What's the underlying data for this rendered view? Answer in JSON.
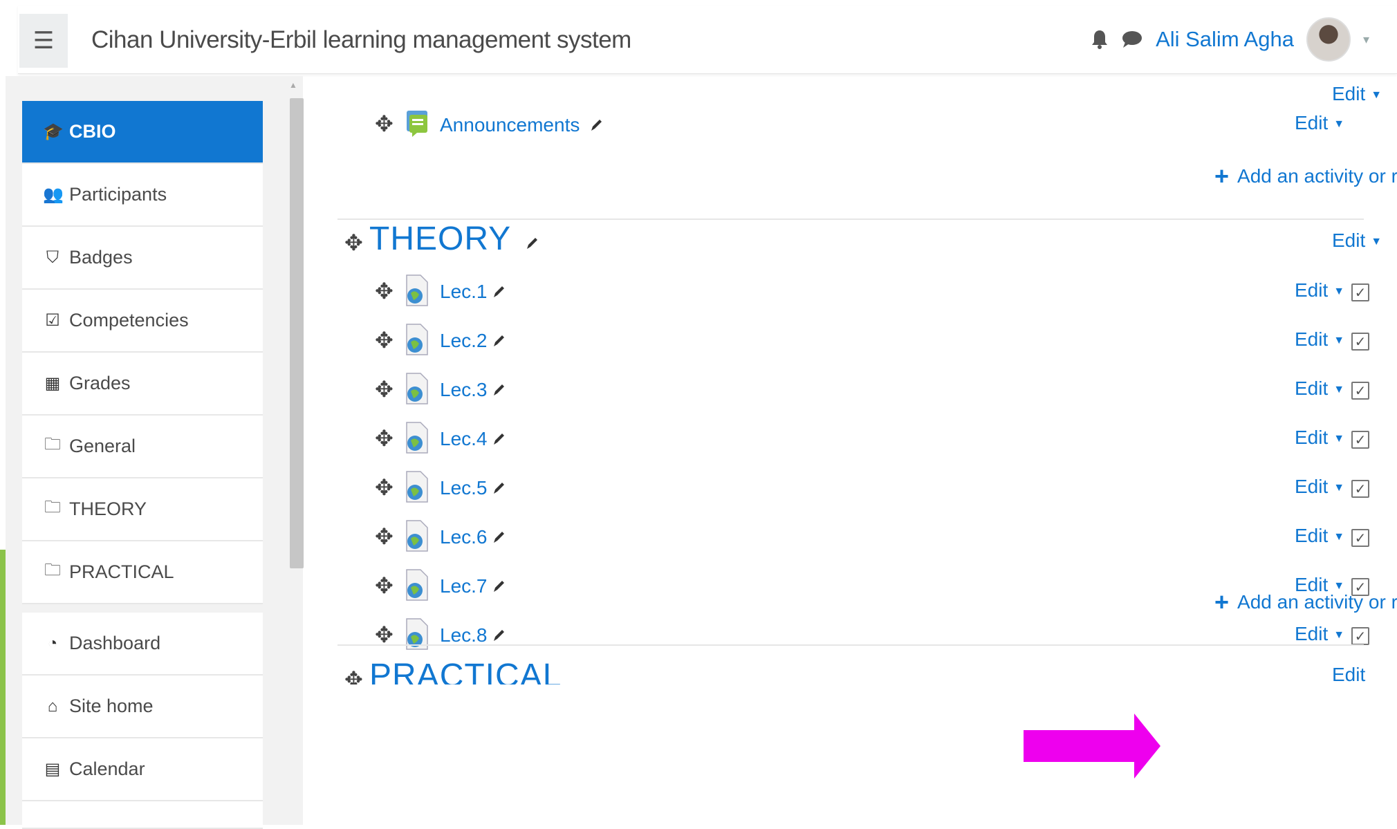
{
  "navbar": {
    "menu_icon": "hamburger-icon",
    "site_title": "Cihan University-Erbil learning management system",
    "user_name": "Ali Salim Agha",
    "icons": [
      "bell-icon",
      "chat-icon",
      "avatar"
    ]
  },
  "sidebar": {
    "course_items": [
      {
        "label": "CBIO",
        "icon": "graduation-cap-icon",
        "active": true
      },
      {
        "label": "Participants",
        "icon": "users-icon"
      },
      {
        "label": "Badges",
        "icon": "shield-icon"
      },
      {
        "label": "Competencies",
        "icon": "checkbox-icon"
      },
      {
        "label": "Grades",
        "icon": "table-icon"
      },
      {
        "label": "General",
        "icon": "folder-icon"
      },
      {
        "label": "THEORY",
        "icon": "folder-icon"
      },
      {
        "label": "PRACTICAL",
        "icon": "folder-icon"
      }
    ],
    "site_items": [
      {
        "label": "Dashboard",
        "icon": "dashboard-icon"
      },
      {
        "label": "Site home",
        "icon": "home-icon"
      },
      {
        "label": "Calendar",
        "icon": "calendar-icon"
      }
    ]
  },
  "general_section": {
    "edit_label": "Edit",
    "activity": {
      "name": "Announcements",
      "icon": "forum-icon",
      "edit_label": "Edit"
    },
    "add_label": "Add an activity or resource"
  },
  "theory_section": {
    "title": "THEORY",
    "edit_label": "Edit",
    "activities": [
      {
        "name": "Lec.1",
        "edit_label": "Edit"
      },
      {
        "name": "Lec.2",
        "edit_label": "Edit"
      },
      {
        "name": "Lec.3",
        "edit_label": "Edit"
      },
      {
        "name": "Lec.4",
        "edit_label": "Edit"
      },
      {
        "name": "Lec.5",
        "edit_label": "Edit"
      },
      {
        "name": "Lec.6",
        "edit_label": "Edit"
      },
      {
        "name": "Lec.7",
        "edit_label": "Edit"
      },
      {
        "name": "Lec.8",
        "edit_label": "Edit"
      }
    ],
    "add_label": "Add an activity or resource"
  },
  "practical_section": {
    "title": "PRACTICAL",
    "edit_label": "Edit"
  },
  "colors": {
    "accent": "#1177d1",
    "callout_arrow": "#ee00ee",
    "left_bar": "#8bc34a"
  }
}
